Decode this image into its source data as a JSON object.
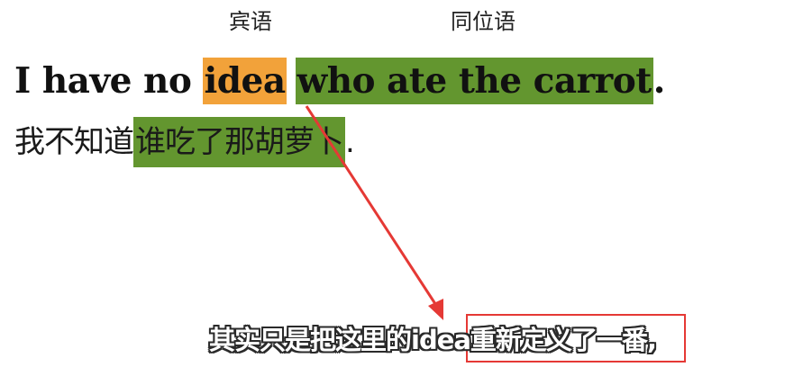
{
  "labels": {
    "object": "宾语",
    "appositive": "同位语"
  },
  "english": {
    "prefix": "I have no ",
    "object": "idea",
    "clause": "who ate the carrot",
    "period": "."
  },
  "chinese": {
    "prefix": "我不知道",
    "clause": "谁吃了那胡萝卜",
    "period": "."
  },
  "subtitle": "其实只是把这里的idea重新定义了一番,",
  "colors": {
    "object_highlight": "#f2a23a",
    "appositive_highlight": "#63962f",
    "annotation_red": "#e53935"
  }
}
